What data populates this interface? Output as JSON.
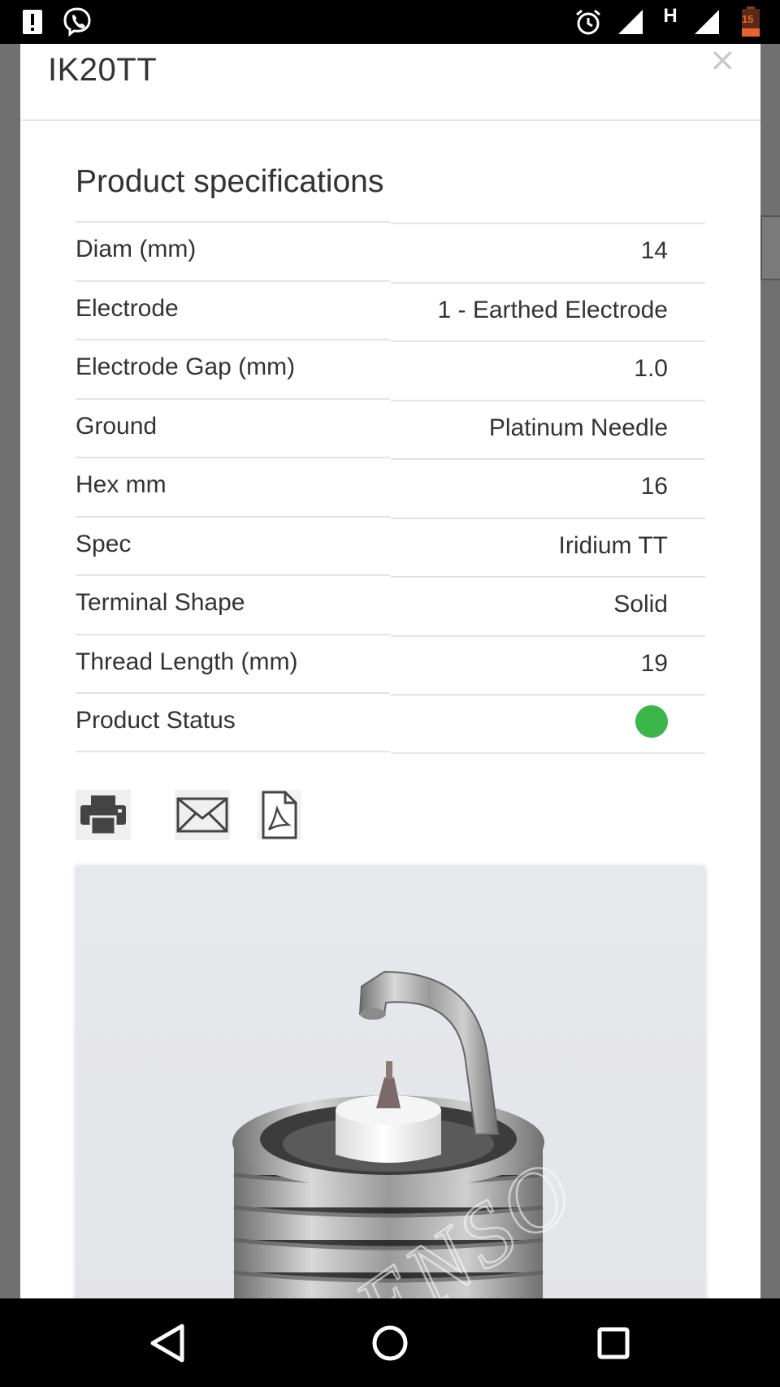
{
  "status_bar": {
    "battery_level": "15",
    "network_type": "H"
  },
  "modal": {
    "title": "IK20TT",
    "close_label": "×",
    "section_title": "Product specifications",
    "specs": [
      {
        "label": "Diam (mm)",
        "value": "14"
      },
      {
        "label": "Electrode",
        "value": "1 - Earthed Electrode"
      },
      {
        "label": "Electrode Gap (mm)",
        "value": "1.0"
      },
      {
        "label": "Ground",
        "value": "Platinum Needle"
      },
      {
        "label": "Hex mm",
        "value": "16"
      },
      {
        "label": "Spec",
        "value": "Iridium TT"
      },
      {
        "label": "Terminal Shape",
        "value": "Solid"
      },
      {
        "label": "Thread Length (mm)",
        "value": "19"
      },
      {
        "label": "Product Status",
        "value": ""
      }
    ],
    "status_color": "#3cb54a",
    "actions": [
      {
        "icon": "printer-icon"
      },
      {
        "icon": "mail-icon"
      },
      {
        "icon": "pdf-icon"
      }
    ],
    "image": {
      "watermark": "DENSO"
    }
  },
  "nav_bar": {
    "back": "back-icon",
    "home": "home-icon",
    "recents": "recents-icon"
  }
}
